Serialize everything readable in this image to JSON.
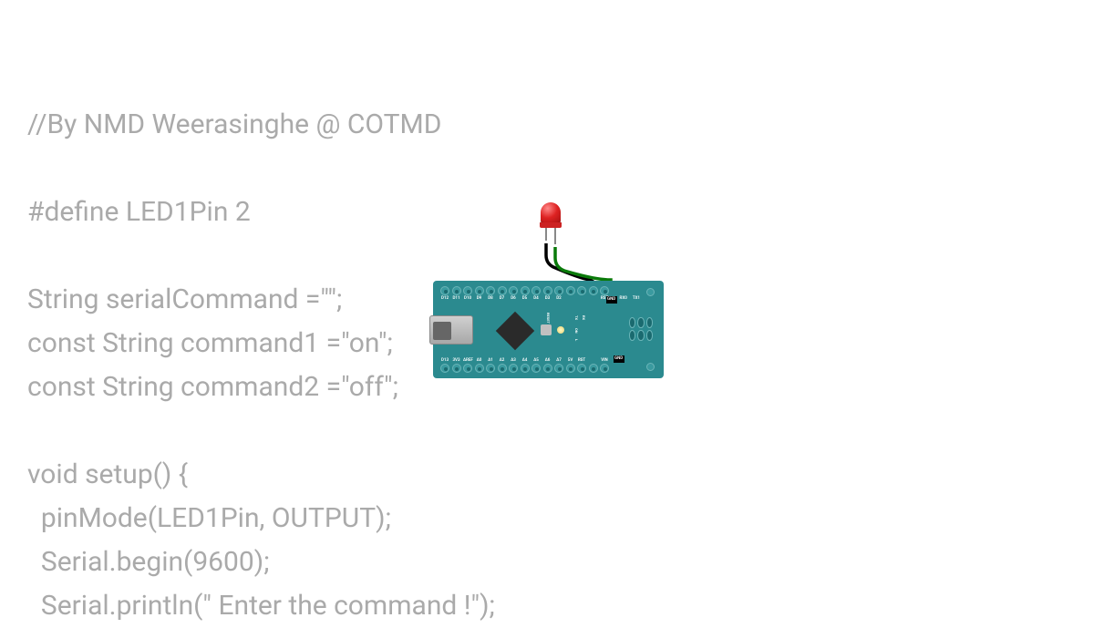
{
  "code": {
    "line1": "//By NMD Weerasinghe @ COTMD",
    "line2": "",
    "line3": "#define LED1Pin 2",
    "line4": "",
    "line5": "String serialCommand =\"\";",
    "line6": "const String command1 =\"on\";",
    "line7": "const String command2 =\"off\";",
    "line8": "",
    "line9": "void setup() {",
    "line10": "  pinMode(LED1Pin, OUTPUT);",
    "line11": "  Serial.begin(9600);",
    "line12": "  Serial.println(\" Enter the command !\");"
  },
  "board": {
    "pins_top": [
      "D12",
      "D11",
      "D10",
      "D9",
      "D8",
      "D7",
      "D6",
      "D5",
      "D4",
      "D3",
      "D2",
      "GND",
      "RST"
    ],
    "pins_bottom": [
      "D13",
      "3V3",
      "AREF",
      "A0",
      "A1",
      "A2",
      "A3",
      "A4",
      "A5",
      "A6",
      "A7",
      "5V",
      "RST",
      "GND",
      "VIN"
    ],
    "reset_label": "RESET",
    "tx": "TX",
    "rx": "RX",
    "on": "ON",
    "l": "L",
    "rx0": "RX0",
    "tx1": "TX1"
  },
  "circuit": {
    "led_color": "#dd2222",
    "wire1_color": "black",
    "wire2_color": "green",
    "connections": [
      "D2",
      "GND"
    ]
  }
}
